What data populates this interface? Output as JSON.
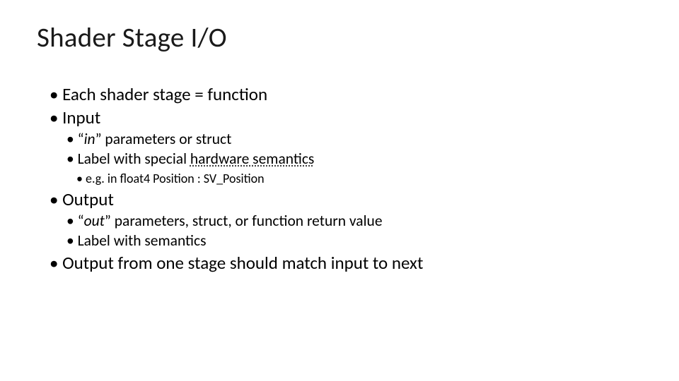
{
  "title": "Shader Stage I/O",
  "bullets": {
    "l1_0": "Each shader stage = function",
    "l1_1": "Input",
    "l2_0_pre": "“",
    "l2_0_em": "in",
    "l2_0_post": "” parameters or struct",
    "l2_1_pre": "Label with special ",
    "l2_1_u": "hardware semantics",
    "l3_0": "e.g. in float4 Position : SV_Position",
    "l1_2": "Output",
    "l2_2_pre": "“",
    "l2_2_em": "out",
    "l2_2_post": "” parameters, struct, or function return value",
    "l2_3": "Label with semantics",
    "l1_3": "Output from one stage should match input to next"
  }
}
